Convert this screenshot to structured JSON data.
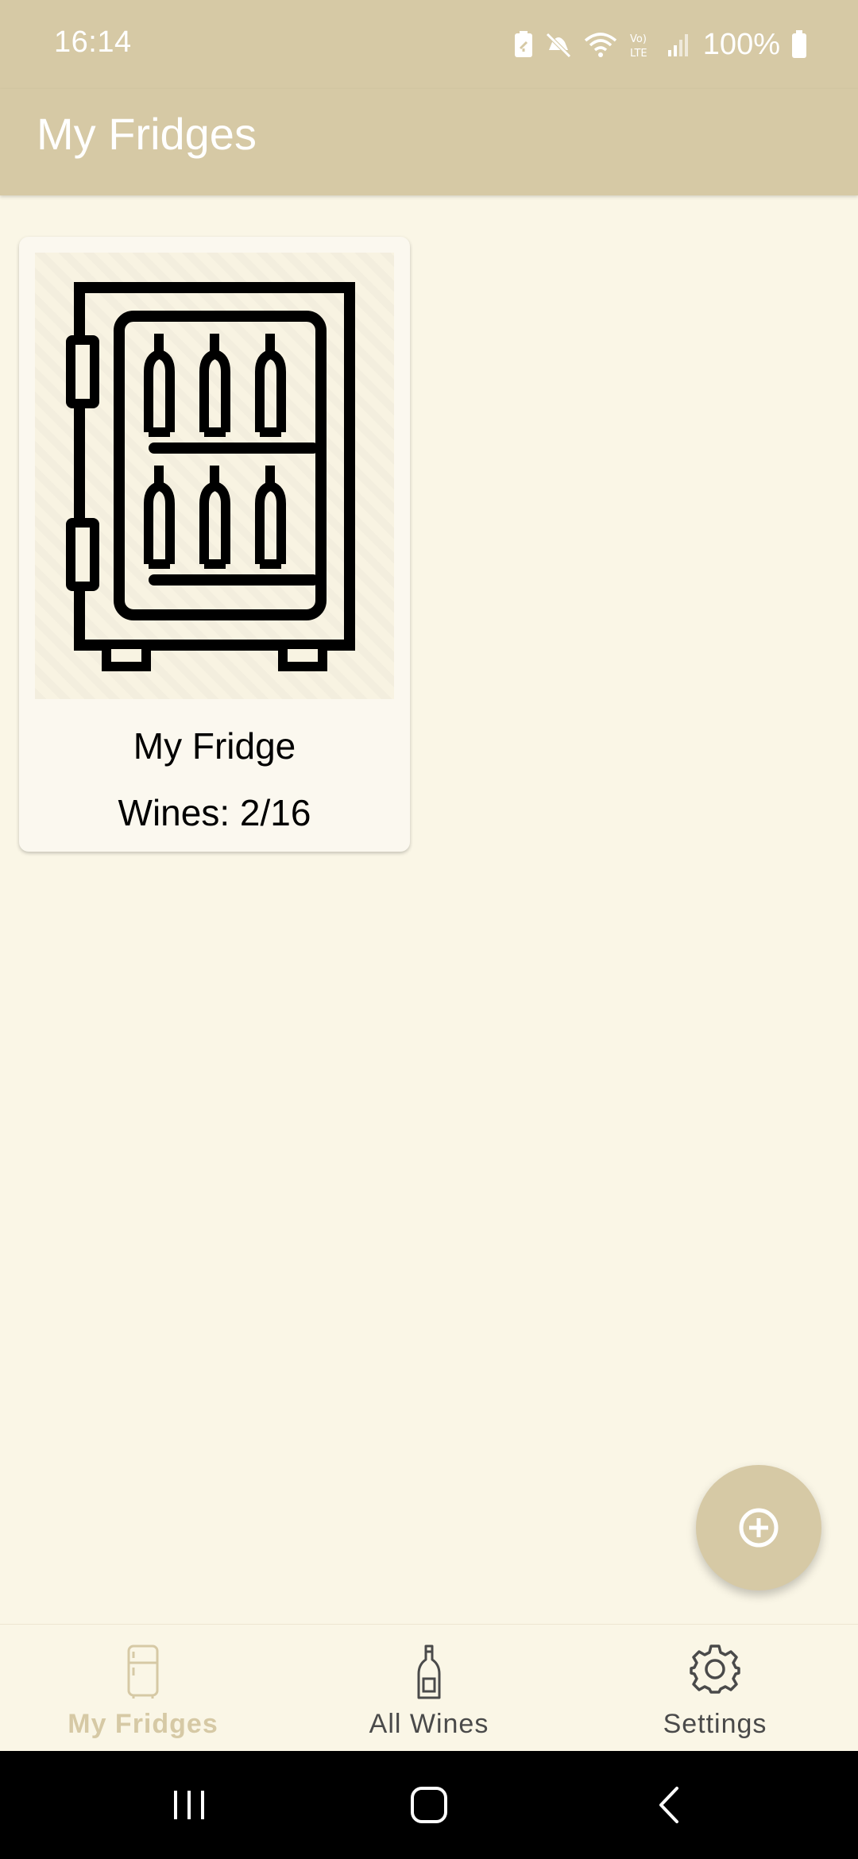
{
  "status_bar": {
    "time": "16:14",
    "battery_percent": "100%",
    "icons": [
      "battery-saver-icon",
      "mute-icon",
      "wifi-icon",
      "volte-icon",
      "signal-icon",
      "battery-icon"
    ]
  },
  "app_bar": {
    "title": "My Fridges"
  },
  "fridges": [
    {
      "name": "My Fridge",
      "wines_label": "Wines: 2/16",
      "icon": "wine-fridge-icon"
    }
  ],
  "fab": {
    "icon": "add-circle-icon"
  },
  "bottom_nav": {
    "items": [
      {
        "label": "My Fridges",
        "icon": "fridge-icon",
        "active": true
      },
      {
        "label": "All Wines",
        "icon": "wine-bottle-icon",
        "active": false
      },
      {
        "label": "Settings",
        "icon": "gear-icon",
        "active": false
      }
    ]
  },
  "system_nav": {
    "icons": [
      "recents-icon",
      "home-icon",
      "back-icon"
    ]
  },
  "colors": {
    "primary": "#D6C9A5",
    "background": "#FAF6E6",
    "card": "#FBF8EF",
    "text": "#000000"
  }
}
